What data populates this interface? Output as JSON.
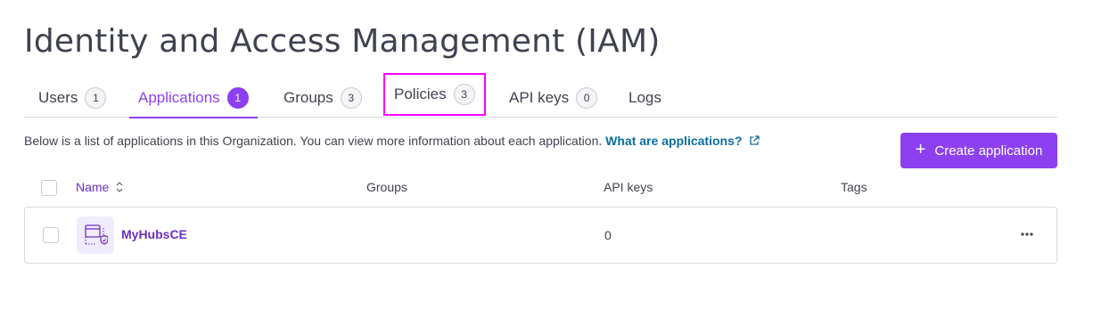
{
  "page": {
    "title": "Identity and Access Management (IAM)"
  },
  "tabs": [
    {
      "label": "Users",
      "count": "1"
    },
    {
      "label": "Applications",
      "count": "1"
    },
    {
      "label": "Groups",
      "count": "3"
    },
    {
      "label": "Policies",
      "count": "3"
    },
    {
      "label": "API keys",
      "count": "0"
    },
    {
      "label": "Logs"
    }
  ],
  "active_tab": "Applications",
  "description": {
    "text": "Below is a list of applications in this Organization. You can view more information about each application.",
    "link": "What are applications?"
  },
  "create_button": {
    "label": "Create application"
  },
  "table": {
    "columns": [
      "Name",
      "Groups",
      "API keys",
      "Tags"
    ],
    "rows": [
      {
        "name": "MyHubsCE",
        "groups": "",
        "api_keys": "0",
        "tags": ""
      }
    ]
  },
  "colors": {
    "accent": "#8c40ef",
    "link": "#0c6e9e",
    "highlight": "#ff00ff"
  },
  "icons": [
    "external-link-icon",
    "plus-icon",
    "sort-icon",
    "application-icon",
    "more-icon"
  ]
}
